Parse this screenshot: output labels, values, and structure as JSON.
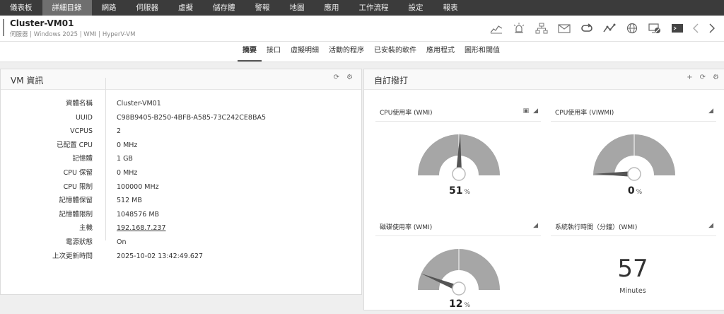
{
  "topnav": [
    {
      "label": "儀表板",
      "active": false
    },
    {
      "label": "詳細目錄",
      "active": true
    },
    {
      "label": "網路",
      "active": false
    },
    {
      "label": "伺服器",
      "active": false
    },
    {
      "label": "虛擬",
      "active": false
    },
    {
      "label": "儲存體",
      "active": false
    },
    {
      "label": "警報",
      "active": false
    },
    {
      "label": "地圖",
      "active": false
    },
    {
      "label": "應用",
      "active": false
    },
    {
      "label": "工作流程",
      "active": false
    },
    {
      "label": "設定",
      "active": false
    },
    {
      "label": "報表",
      "active": false
    }
  ],
  "header": {
    "title": "Cluster-VM01",
    "subtitle": "伺服器 | Windows 2025 | WMI | HyperV-VM"
  },
  "toolbar_icons": [
    "chart-icon",
    "alarm-icon",
    "network-icon",
    "email-icon",
    "sync-icon",
    "trend-icon",
    "globe-icon",
    "monitor-disable-icon",
    "terminal-icon",
    "chevron-left-icon",
    "chevron-right-icon"
  ],
  "tabs": [
    {
      "label": "摘要",
      "active": true
    },
    {
      "label": "接口",
      "active": false
    },
    {
      "label": "虛擬明細",
      "active": false
    },
    {
      "label": "活動的程序",
      "active": false
    },
    {
      "label": "已安裝的軟件",
      "active": false
    },
    {
      "label": "應用程式",
      "active": false
    },
    {
      "label": "圖形和閾值",
      "active": false
    }
  ],
  "vm_panel": {
    "title": "VM 資訊",
    "rows": [
      {
        "key": "資體名稱",
        "value": "Cluster-VM01"
      },
      {
        "key": "UUID",
        "value": "C98B9405-B250-4BFB-A585-73C242CE8BA5"
      },
      {
        "key": "VCPUS",
        "value": "2"
      },
      {
        "key": "已配置 CPU",
        "value": "0 MHz"
      },
      {
        "key": "記憶體",
        "value": "1 GB"
      },
      {
        "key": "CPU 保留",
        "value": "0 MHz"
      },
      {
        "key": "CPU 限制",
        "value": "100000 MHz"
      },
      {
        "key": "記憶體保留",
        "value": "512 MB"
      },
      {
        "key": "記憶體限制",
        "value": "1048576 MB"
      },
      {
        "key": "主機",
        "value": "192.168.7.237"
      },
      {
        "key": "電源狀態",
        "value": "On"
      },
      {
        "key": "上次更新時間",
        "value": "2025-10-02 13:42:49.627"
      }
    ]
  },
  "custom_panel": {
    "title": "自訂撥打",
    "widgets": [
      {
        "title": "CPU使用率 (WMI)",
        "value": "51",
        "unit": "%",
        "percent": 51
      },
      {
        "title": "CPU使用率 (VIWMI)",
        "value": "0",
        "unit": "%",
        "percent": 0
      },
      {
        "title": "磁碟使用率 (WMI)",
        "value": "12",
        "unit": "%",
        "percent": 12
      },
      {
        "title": "系統執行時間（分鐘）(WMI)",
        "value": "57",
        "unit": "Minutes"
      }
    ]
  },
  "colors": {
    "nav_bg": "#3b3b3b",
    "nav_active": "#6f6f6f",
    "gauge_fill": "#a6a6a6",
    "needle": "#555555"
  }
}
